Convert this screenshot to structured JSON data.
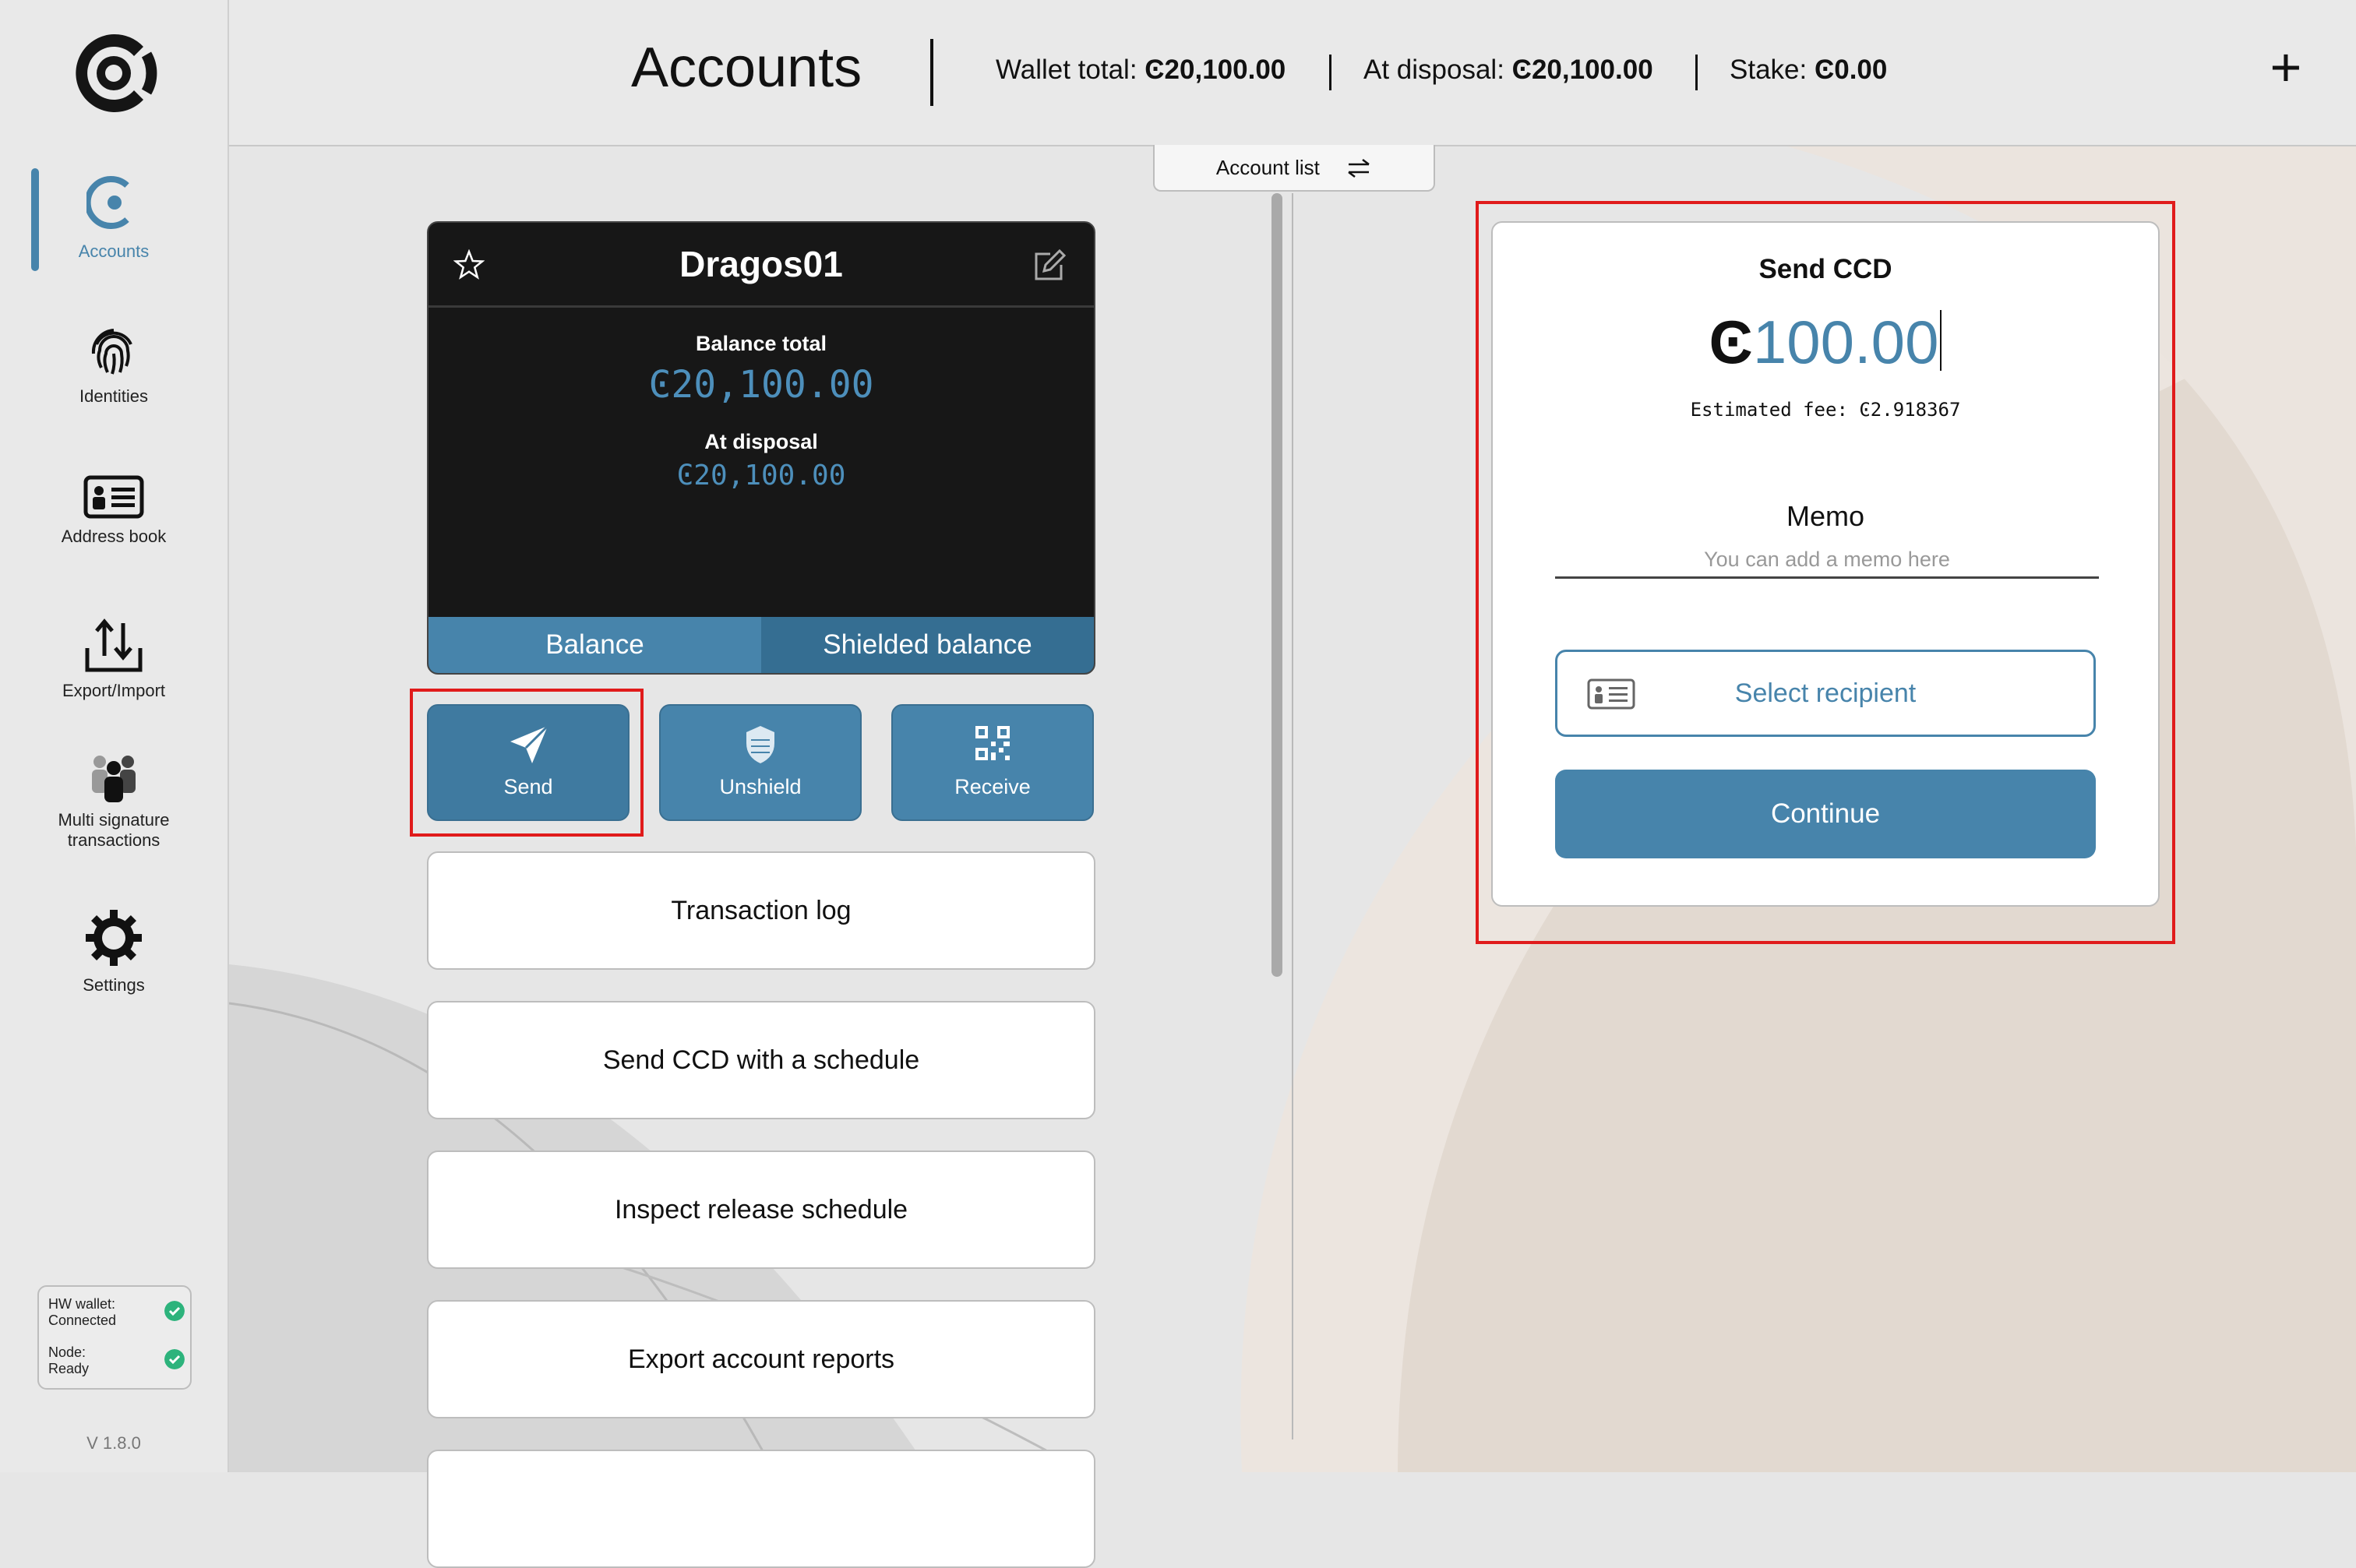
{
  "sidebar": {
    "items": [
      {
        "label": "Accounts",
        "icon": "accounts-icon"
      },
      {
        "label": "Identities",
        "icon": "fingerprint-icon"
      },
      {
        "label": "Address book",
        "icon": "address-book-icon"
      },
      {
        "label": "Export/Import",
        "icon": "export-import-icon"
      },
      {
        "label_line1": "Multi signature",
        "label_line2": "transactions",
        "icon": "multisig-people-icon"
      },
      {
        "label": "Settings",
        "icon": "gear-icon"
      }
    ],
    "status": {
      "hw_label": "HW wallet:",
      "hw_value": "Connected",
      "node_label": "Node:",
      "node_value": "Ready"
    },
    "version": "V 1.8.0"
  },
  "header": {
    "title": "Accounts",
    "wallet_total_label": "Wallet total:",
    "wallet_total_value": "Ͼ20,100.00",
    "at_disposal_label": "At disposal:",
    "at_disposal_value": "Ͼ20,100.00",
    "stake_label": "Stake:",
    "stake_value": "Ͼ0.00",
    "add_label": "+"
  },
  "account_list_tab": {
    "label": "Account list",
    "icon": "swap-arrows-icon"
  },
  "account_card": {
    "name": "Dragos01",
    "balance_total_label": "Balance total",
    "balance_total_value": "Ͼ20,100.00",
    "at_disposal_label": "At disposal",
    "at_disposal_value": "Ͼ20,100.00",
    "tabs": [
      "Balance",
      "Shielded balance"
    ]
  },
  "actions": [
    {
      "label": "Send",
      "icon": "paper-plane-icon"
    },
    {
      "label": "Unshield",
      "icon": "shield-icon"
    },
    {
      "label": "Receive",
      "icon": "qr-code-icon"
    }
  ],
  "menu_buttons": [
    "Transaction log",
    "Send CCD with a schedule",
    "Inspect release schedule",
    "Export account reports"
  ],
  "send_panel": {
    "title": "Send CCD",
    "currency_symbol": "Ͼ",
    "amount": "100.00",
    "estimated_fee": "Estimated fee: Ͼ2.918367",
    "memo_label": "Memo",
    "memo_placeholder": "You can add a memo here",
    "select_recipient": "Select recipient",
    "continue": "Continue"
  },
  "colors": {
    "accent": "#4784ab",
    "accent_dark": "#356e92",
    "highlight": "#e01b1b",
    "status_ok": "#2db37c",
    "card_bg": "#171717"
  }
}
